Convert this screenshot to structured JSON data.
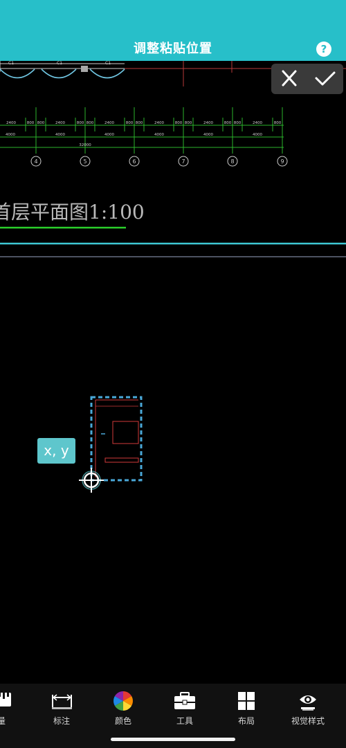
{
  "header": {
    "title": "调整粘贴位置",
    "help_label": "?"
  },
  "drawing": {
    "title_text": "首层平面图1:100",
    "window_labels": [
      "C1",
      "C1",
      "C1"
    ],
    "dim_small": [
      "2400",
      "800",
      "800",
      "2400",
      "800",
      "800",
      "2400",
      "800",
      "800",
      "2400",
      "800",
      "800",
      "2400",
      "800",
      "800",
      "2400",
      "800"
    ],
    "dim_mid": [
      "4000",
      "4000",
      "4000",
      "4000",
      "4000",
      "4000"
    ],
    "dim_total": "32000",
    "axis_labels": [
      "4",
      "5",
      "6",
      "7",
      "8",
      "9"
    ]
  },
  "coord_tip": "x, y",
  "toolbar": {
    "items": [
      {
        "label": "量",
        "icon": "ruler-icon"
      },
      {
        "label": "标注",
        "icon": "dimension-icon"
      },
      {
        "label": "颜色",
        "icon": "color-wheel-icon"
      },
      {
        "label": "工具",
        "icon": "toolbox-icon"
      },
      {
        "label": "布局",
        "icon": "layout-grid-icon"
      },
      {
        "label": "视觉样式",
        "icon": "eye-icon"
      }
    ]
  },
  "colors": {
    "header_bg": "#27bfc9",
    "canvas_bg": "#000000",
    "tooltip_bg": "#5ec6cc",
    "selection": "#4aa8d8"
  }
}
